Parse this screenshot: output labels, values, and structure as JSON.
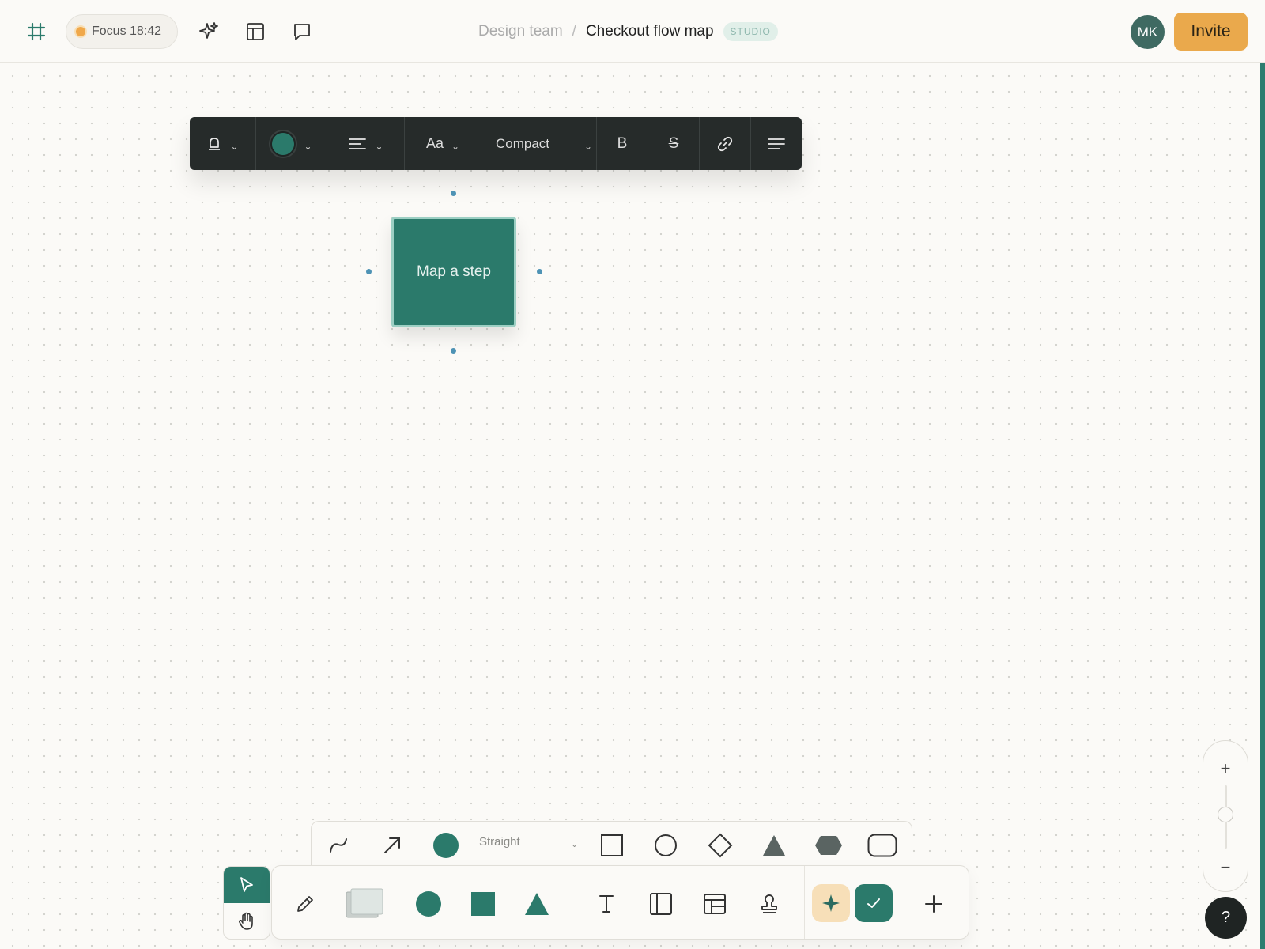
{
  "topbar": {
    "focus": "Focus 18:42",
    "breadcrumb": {
      "team": "Design team",
      "separator": "/",
      "title": "Checkout flow map",
      "badge": "STUDIO"
    },
    "avatar_initials": "MK",
    "invite_label": "Invite"
  },
  "format_toolbar": {
    "fill_color": "#2b7a6b",
    "font_label": "Aa",
    "size_label": "Compact",
    "bold_label": "B",
    "strike_label": "S"
  },
  "canvas": {
    "node_label": "Map a step",
    "node_color": "#2b7a6b"
  },
  "shape_toolbar": {
    "line_style": "Straight"
  },
  "zoom": {
    "in_label": "+",
    "out_label": "−"
  },
  "help_label": "?",
  "colors": {
    "accent": "#2b7a6b",
    "invite": "#eaa94c",
    "toolbar_dark": "#262b2a"
  }
}
